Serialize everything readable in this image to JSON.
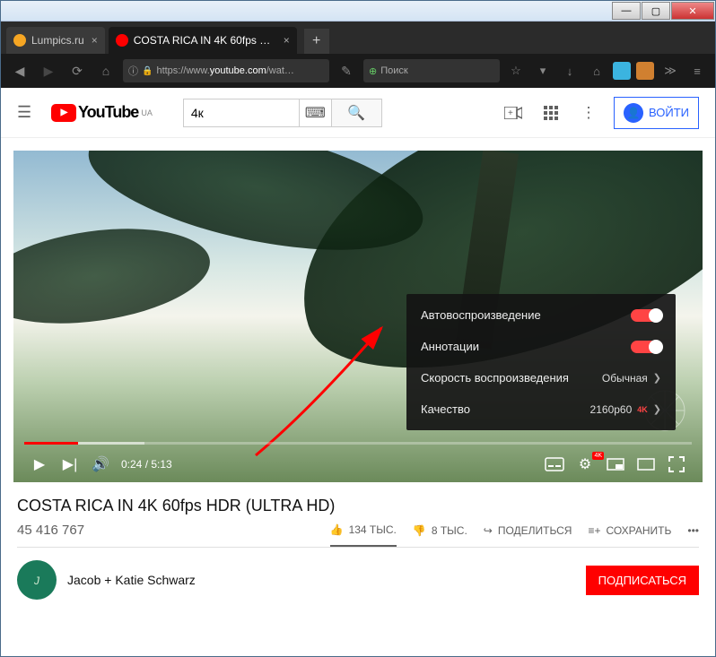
{
  "window": {
    "minimize": "—",
    "maximize": "▢",
    "close": "✕"
  },
  "browser": {
    "tabs": [
      {
        "title": "Lumpics.ru",
        "favicon_color": "#f6a623"
      },
      {
        "title": "COSTA RICA IN 4K 60fps HD...",
        "favicon_color": "#ff0000"
      }
    ],
    "url_prefix": "https://www.",
    "url_domain": "youtube.com",
    "url_rest": "/wat…",
    "search_placeholder": "Поиск"
  },
  "yt": {
    "logo": "YouTube",
    "region": "UA",
    "search_value": "4к",
    "signin": "ВОЙТИ"
  },
  "player": {
    "time_current": "0:24",
    "time_total": "5:13",
    "settings": {
      "autoplay_label": "Автовоспроизведение",
      "annotations_label": "Аннотации",
      "speed_label": "Скорость воспроизведения",
      "speed_value": "Обычная",
      "quality_label": "Качество",
      "quality_value": "2160p60",
      "quality_badge": "4K"
    }
  },
  "video": {
    "title": "COSTA RICA IN 4K 60fps HDR (ULTRA HD)",
    "views": "45 416 767",
    "likes": "134 ТЫС.",
    "dislikes": "8 ТЫС.",
    "share": "ПОДЕЛИТЬСЯ",
    "save": "СОХРАНИТЬ"
  },
  "channel": {
    "name": "Jacob + Katie Schwarz",
    "subscribe": "ПОДПИСАТЬСЯ"
  }
}
